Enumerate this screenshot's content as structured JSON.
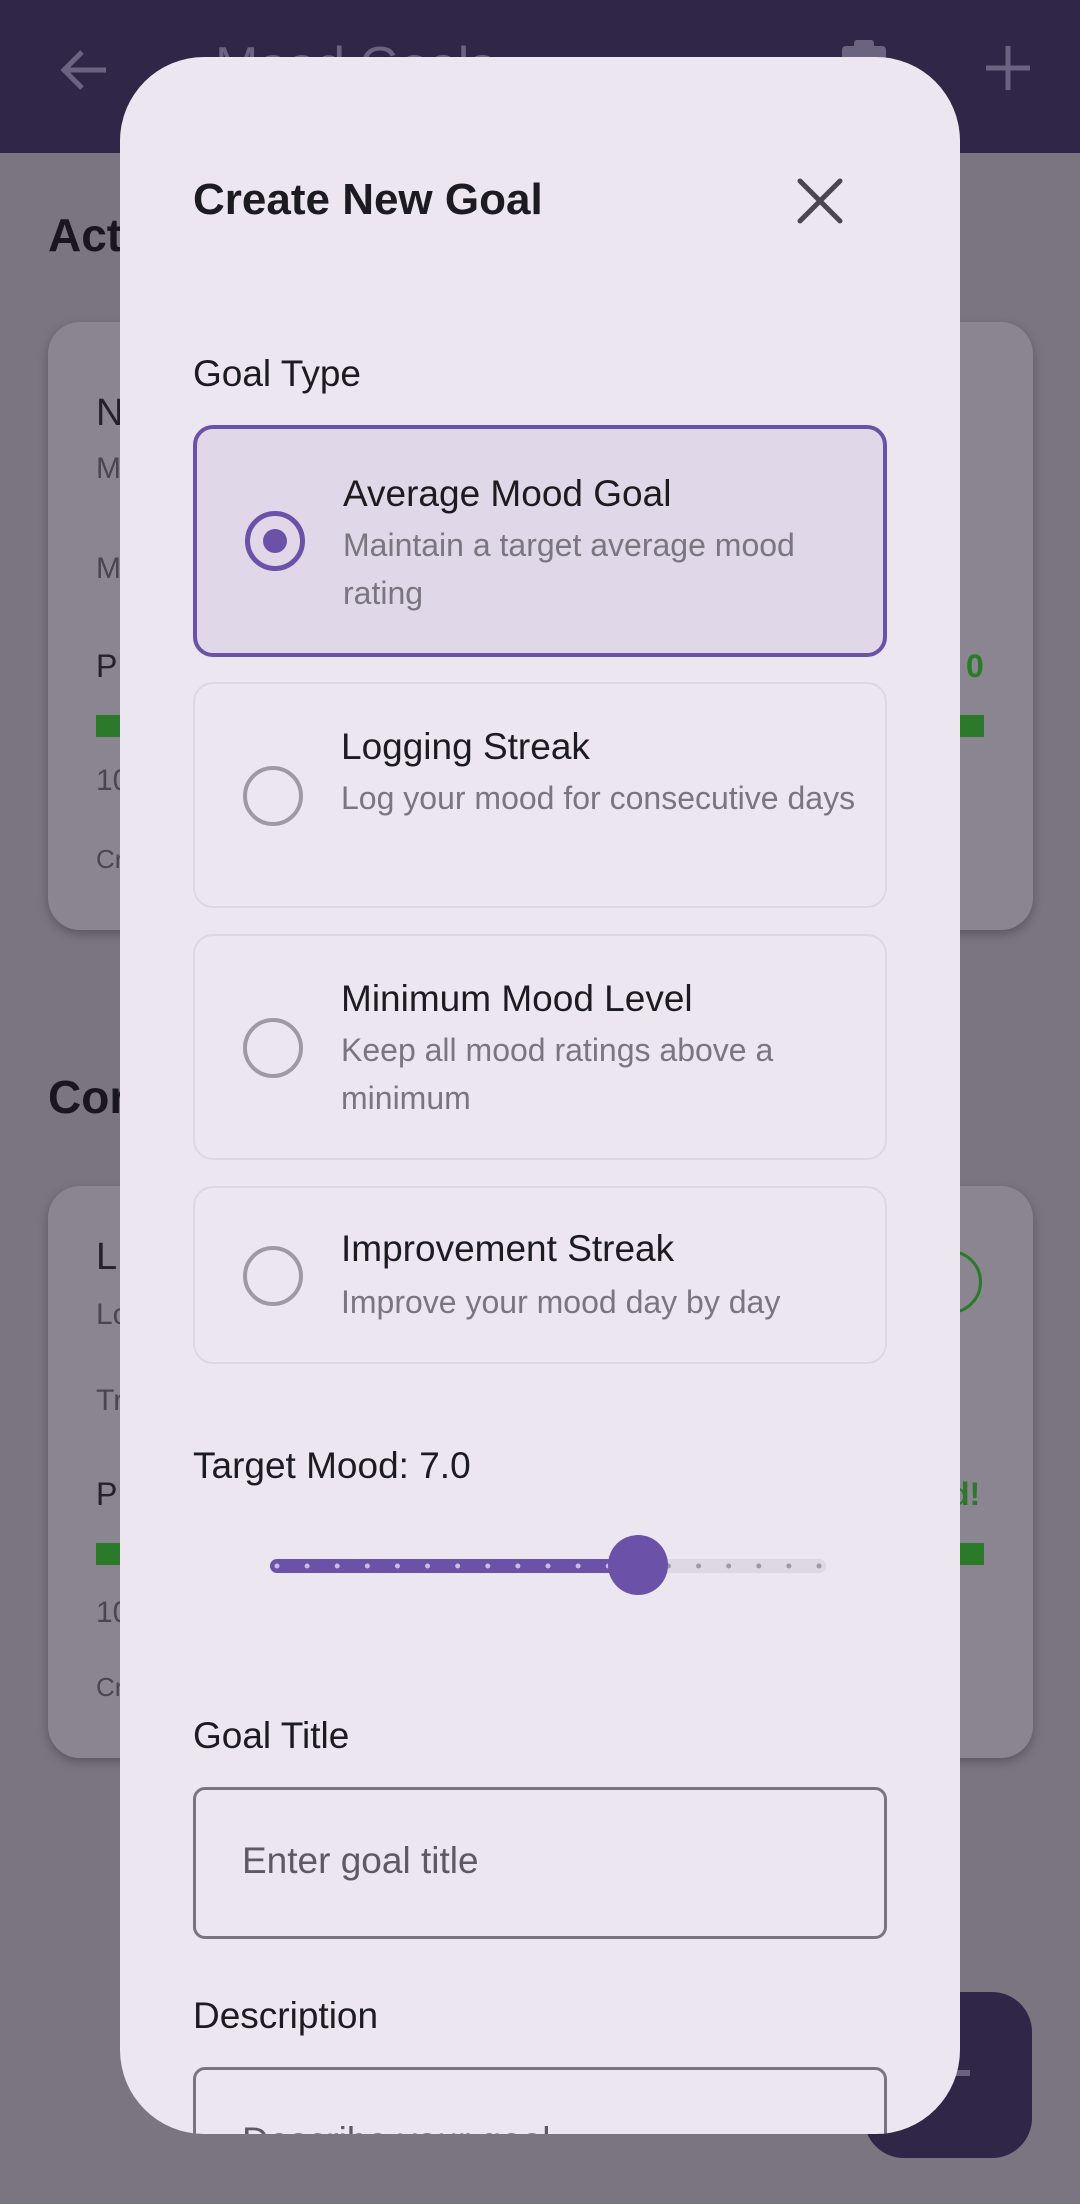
{
  "background": {
    "app_bar": {
      "title": "Mood Goals",
      "back_icon": "arrow-left-icon",
      "clipboard_icon": "clipboard-icon",
      "add_icon": "plus-icon"
    },
    "active_heading": "Act",
    "completed_heading": "Cor",
    "card1": {
      "letter": "N",
      "sub": "M",
      "row": "M",
      "progress_label": "P",
      "count": "10",
      "created": "Cr",
      "right_value": "0"
    },
    "card2": {
      "letter": "L",
      "sub": "Lc",
      "row": "Tr",
      "progress_label": "P",
      "count": "10",
      "created": "Cr",
      "right_value": "d!"
    }
  },
  "dialog": {
    "title": "Create New Goal",
    "close_icon": "close-icon",
    "goal_type_label": "Goal Type",
    "options": [
      {
        "title": "Average Mood Goal",
        "description": "Maintain a target average mood rating",
        "selected": true
      },
      {
        "title": "Logging Streak",
        "description": "Log your mood for consecutive days",
        "selected": false
      },
      {
        "title": "Minimum Mood Level",
        "description": "Keep all mood ratings above a minimum",
        "selected": false
      },
      {
        "title": "Improvement Streak",
        "description": "Improve your mood day by day",
        "selected": false
      }
    ],
    "target_label": "Target Mood: 7.0",
    "slider": {
      "min": 1,
      "max": 10,
      "value": 7.0,
      "accent": "#6b52a8"
    },
    "goal_title_label": "Goal Title",
    "goal_title_placeholder": "Enter goal title",
    "description_label": "Description",
    "description_placeholder": "Describe your goal"
  }
}
